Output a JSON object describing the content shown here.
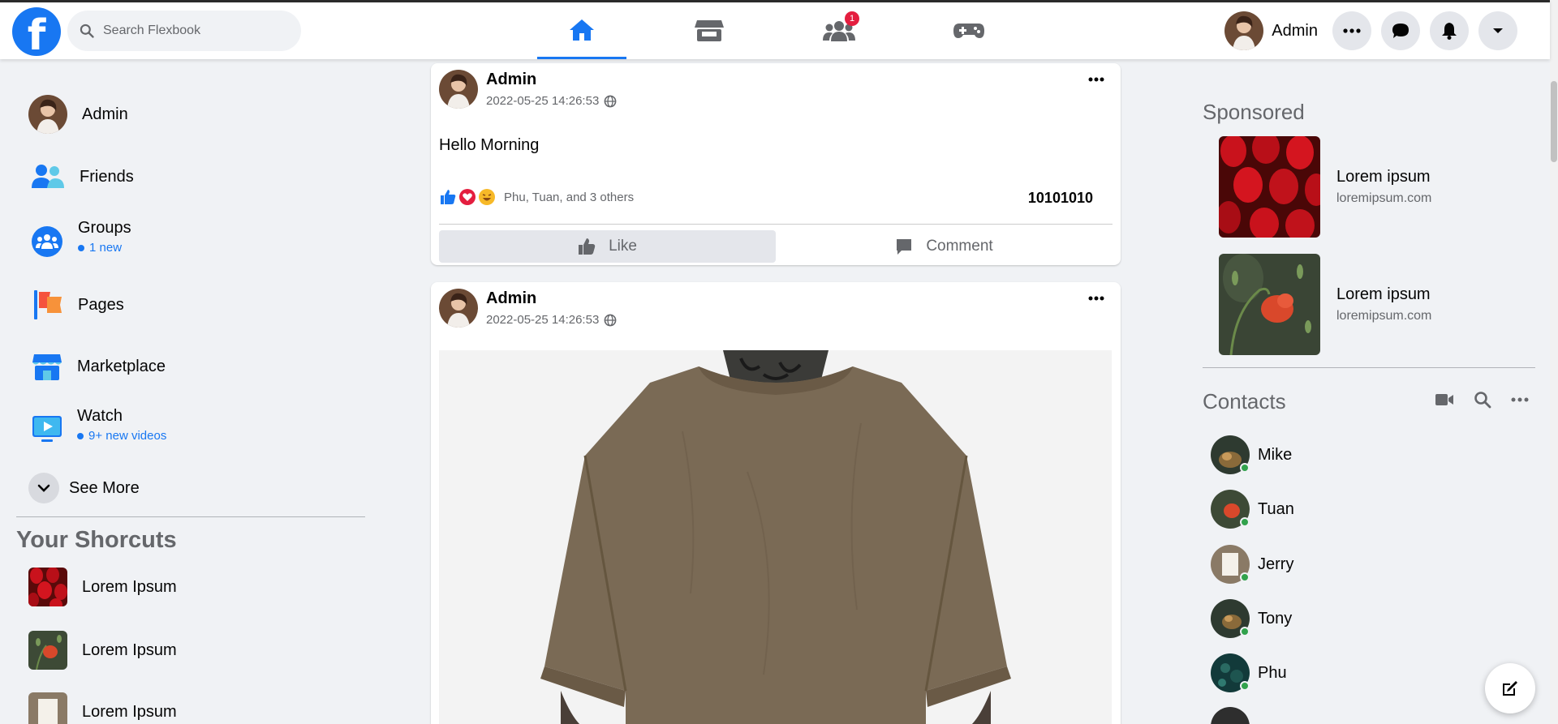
{
  "header": {
    "search_placeholder": "Search Flexbook",
    "logo_letter": "f",
    "group_badge": "1",
    "user_name": "Admin"
  },
  "sidebar": {
    "profile": "Admin",
    "items": [
      {
        "label": "Friends",
        "sub": ""
      },
      {
        "label": "Groups",
        "sub": "1 new"
      },
      {
        "label": "Pages",
        "sub": ""
      },
      {
        "label": "Marketplace",
        "sub": ""
      },
      {
        "label": "Watch",
        "sub": "9+ new videos"
      }
    ],
    "see_more": "See More",
    "shortcuts_title": "Your Shorcuts",
    "shortcuts": [
      "Lorem Ipsum",
      "Lorem Ipsum",
      "Lorem Ipsum"
    ]
  },
  "feed": {
    "posts": [
      {
        "author": "Admin",
        "time": "2022-05-25 14:26:53",
        "text": "Hello Morning",
        "reaction_names": "Phu, Tuan, and 3 others",
        "count": "10101010",
        "like_label": "Like",
        "comment_label": "Comment"
      },
      {
        "author": "Admin",
        "time": "2022-05-25 14:26:53"
      }
    ]
  },
  "right": {
    "sponsored_title": "Sponsored",
    "sponsored": [
      {
        "title": "Lorem ipsum",
        "domain": "loremipsum.com"
      },
      {
        "title": "Lorem ipsum",
        "domain": "loremipsum.com"
      }
    ],
    "contacts_title": "Contacts",
    "contacts": [
      "Mike",
      "Tuan",
      "Jerry",
      "Tony",
      "Phu"
    ]
  },
  "colors": {
    "accent": "#1877f2",
    "background": "#f0f2f5",
    "online": "#31a24c",
    "badge": "#e41e3f"
  }
}
